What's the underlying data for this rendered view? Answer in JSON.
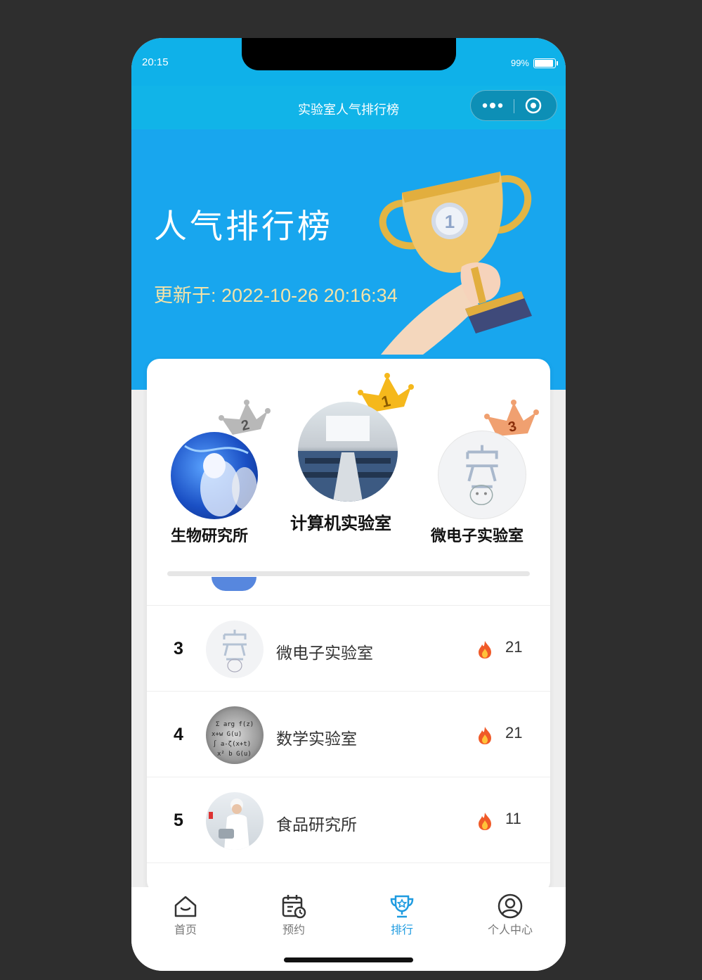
{
  "status_bar": {
    "time": "20:15",
    "battery": "99%"
  },
  "nav": {
    "title": "实验室人气排行榜"
  },
  "banner": {
    "title": "人气排行榜",
    "updated": "更新于: 2022-10-26 20:16:34"
  },
  "podium": [
    {
      "rank": 2,
      "name": "生物研究所",
      "crown_color": "#b8b8b8"
    },
    {
      "rank": 1,
      "name": "计算机实验室",
      "crown_color": "#f5b81c"
    },
    {
      "rank": 3,
      "name": "微电子实验室",
      "crown_color": "#f0a070"
    }
  ],
  "list": [
    {
      "rank": "3",
      "name": "微电子实验室",
      "count": "21"
    },
    {
      "rank": "4",
      "name": "数学实验室",
      "count": "21"
    },
    {
      "rank": "5",
      "name": "食品研究所",
      "count": "11"
    }
  ],
  "tabs": [
    {
      "label": "首页",
      "icon": "home-icon"
    },
    {
      "label": "预约",
      "icon": "calendar-icon"
    },
    {
      "label": "排行",
      "icon": "trophy-icon"
    },
    {
      "label": "个人中心",
      "icon": "user-icon"
    }
  ],
  "colors": {
    "accent": "#18a6ee",
    "active_tab": "#1e9be0",
    "fire": "#f05a28"
  }
}
